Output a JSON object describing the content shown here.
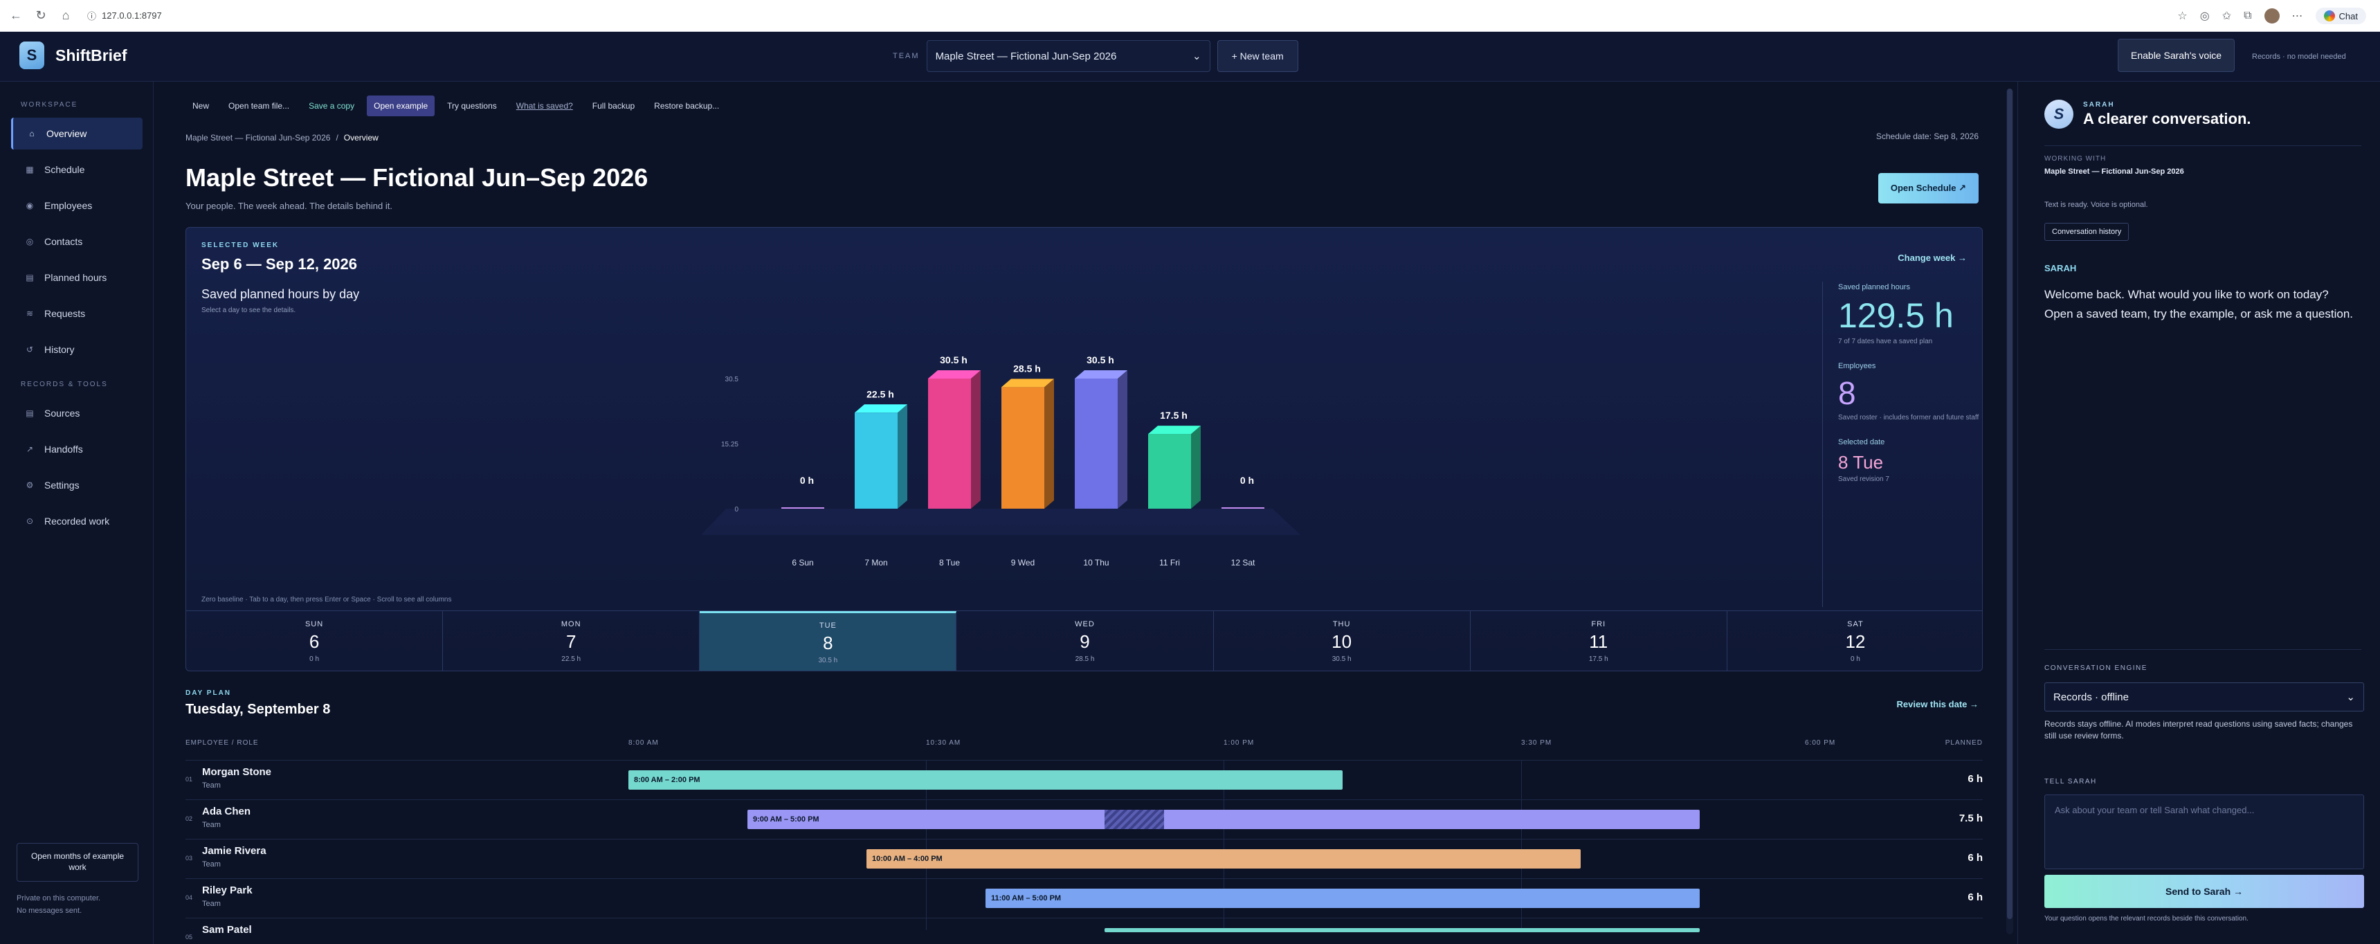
{
  "browser": {
    "url": "127.0.0.1:8797",
    "chat_label": "Chat"
  },
  "header": {
    "brand_initial": "S",
    "brand_name": "ShiftBrief",
    "team_label": "TEAM",
    "team_selected": "Maple Street — Fictional Jun-Sep 2026",
    "new_team_label": "+ New team",
    "enable_voice_label": "Enable Sarah's voice",
    "records_note": "Records · no model needed"
  },
  "sidebar": {
    "workspace_label": "WORKSPACE",
    "workspace_items": [
      {
        "label": "Overview",
        "icon": "home-icon",
        "active": true
      },
      {
        "label": "Schedule",
        "icon": "calendar-icon"
      },
      {
        "label": "Employees",
        "icon": "person-icon"
      },
      {
        "label": "Contacts",
        "icon": "contact-icon"
      },
      {
        "label": "Planned hours",
        "icon": "hours-icon"
      },
      {
        "label": "Requests",
        "icon": "requests-icon"
      },
      {
        "label": "History",
        "icon": "history-icon"
      }
    ],
    "tools_label": "RECORDS & TOOLS",
    "tools_items": [
      {
        "label": "Sources",
        "icon": "sources-icon"
      },
      {
        "label": "Handoffs",
        "icon": "handoff-icon"
      },
      {
        "label": "Settings",
        "icon": "gear-icon"
      },
      {
        "label": "Recorded work",
        "icon": "recorded-icon"
      }
    ],
    "example_button": "Open months of example work",
    "footer_line1": "Private on this computer.",
    "footer_line2": "No messages sent."
  },
  "toolbar": {
    "items": [
      "New",
      "Open team file...",
      "Save a copy",
      "Open example",
      "Try questions",
      "What is saved?",
      "Full backup",
      "Restore backup..."
    ]
  },
  "breadcrumb": {
    "team": "Maple Street — Fictional Jun-Sep 2026",
    "separator": "/",
    "current": "Overview"
  },
  "schedule_date": "Schedule date: Sep 8, 2026",
  "page": {
    "title": "Maple Street — Fictional Jun–Sep 2026",
    "subtitle": "Your people. The week ahead. The details behind it.",
    "open_schedule": "Open Schedule ↗"
  },
  "week": {
    "kicker": "SELECTED WEEK",
    "range": "Sep 6 — Sep 12, 2026",
    "change_week": "Change week →",
    "chart_title": "Saved planned hours by day",
    "chart_hint": "Select a day to see the details.",
    "footnote": "Zero baseline · Tab to a day, then press Enter or Space · Scroll to see all columns",
    "stats": {
      "planned_label": "Saved planned hours",
      "planned_value": "129.5 h",
      "planned_sub": "7 of 7 dates have a saved plan",
      "employees_label": "Employees",
      "employees_value": "8",
      "employees_sub": "Saved roster · includes former and future staff",
      "selected_label": "Selected date",
      "selected_value": "8 Tue",
      "selected_sub": "Saved revision 7"
    },
    "days": [
      {
        "name": "SUN",
        "date": "6",
        "hours": "0 h"
      },
      {
        "name": "MON",
        "date": "7",
        "hours": "22.5 h"
      },
      {
        "name": "TUE",
        "date": "8",
        "hours": "30.5 h",
        "active": true
      },
      {
        "name": "WED",
        "date": "9",
        "hours": "28.5 h"
      },
      {
        "name": "THU",
        "date": "10",
        "hours": "30.5 h"
      },
      {
        "name": "FRI",
        "date": "11",
        "hours": "17.5 h"
      },
      {
        "name": "SAT",
        "date": "12",
        "hours": "0 h"
      }
    ]
  },
  "chart_data": {
    "type": "bar",
    "categories": [
      "6 Sun",
      "7 Mon",
      "8 Tue",
      "9 Wed",
      "10 Thu",
      "11 Fri",
      "12 Sat"
    ],
    "values": [
      0,
      22.5,
      30.5,
      28.5,
      30.5,
      17.5,
      0
    ],
    "value_labels": [
      "0 h",
      "22.5 h",
      "30.5 h",
      "28.5 h",
      "30.5 h",
      "17.5 h",
      "0 h"
    ],
    "yticks": [
      "0",
      "15.25",
      "30.5"
    ],
    "ylim": [
      0,
      30.5
    ],
    "colors": [
      "#c58cf0",
      "#38c8e8",
      "#e9438f",
      "#f08a2a",
      "#6f71e6",
      "#2fcf9c",
      "#c58cf0"
    ]
  },
  "day_plan": {
    "kicker": "DAY PLAN",
    "title": "Tuesday, September 8",
    "review": "Review this date →",
    "col_employee": "EMPLOYEE / ROLE",
    "col_planned": "PLANNED",
    "time_ticks": [
      "8:00 AM",
      "10:30 AM",
      "1:00 PM",
      "3:30 PM",
      "6:00 PM"
    ],
    "rows": [
      {
        "idx": "01",
        "name": "Morgan Stone",
        "role": "Team",
        "shift": "8:00 AM – 2:00 PM",
        "start": 8,
        "end": 14,
        "planned": "6 h",
        "color": "#74d8cf"
      },
      {
        "idx": "02",
        "name": "Ada Chen",
        "role": "Team",
        "shift": "9:00 AM – 5:00 PM",
        "start": 9,
        "end": 17,
        "planned": "7.5 h",
        "color": "#9a96f5",
        "break_start": 12,
        "break_end": 12.5
      },
      {
        "idx": "03",
        "name": "Jamie Rivera",
        "role": "Team",
        "shift": "10:00 AM – 4:00 PM",
        "start": 10,
        "end": 16,
        "planned": "6 h",
        "color": "#e7b07e"
      },
      {
        "idx": "04",
        "name": "Riley Park",
        "role": "Team",
        "shift": "11:00 AM – 5:00 PM",
        "start": 11,
        "end": 17,
        "planned": "6 h",
        "color": "#7aa4f2"
      },
      {
        "idx": "05",
        "name": "Sam Patel",
        "role": "",
        "shift": "",
        "start": 12,
        "end": 17,
        "planned": "",
        "color": "#74d8cf"
      }
    ]
  },
  "sarah": {
    "avatar": "S",
    "kicker": "SARAH",
    "title": "A clearer conversation.",
    "working_label": "WORKING WITH",
    "working_value": "Maple Street — Fictional Jun-Sep 2026",
    "ready": "Text is ready. Voice is optional.",
    "history_button": "Conversation history",
    "speaker": "SARAH",
    "message": "Welcome back. What would you like to work on today? Open a saved team, try the example, or ask me a question.",
    "engine_label": "CONVERSATION ENGINE",
    "engine_value": "Records · offline",
    "engine_note": "Records stays offline. AI modes interpret read questions using saved facts; changes still use review forms.",
    "tell_label": "TELL SARAH",
    "placeholder": "Ask about your team or tell Sarah what changed...",
    "send": "Send to Sarah →",
    "foot": "Your question opens the relevant records beside this conversation."
  }
}
